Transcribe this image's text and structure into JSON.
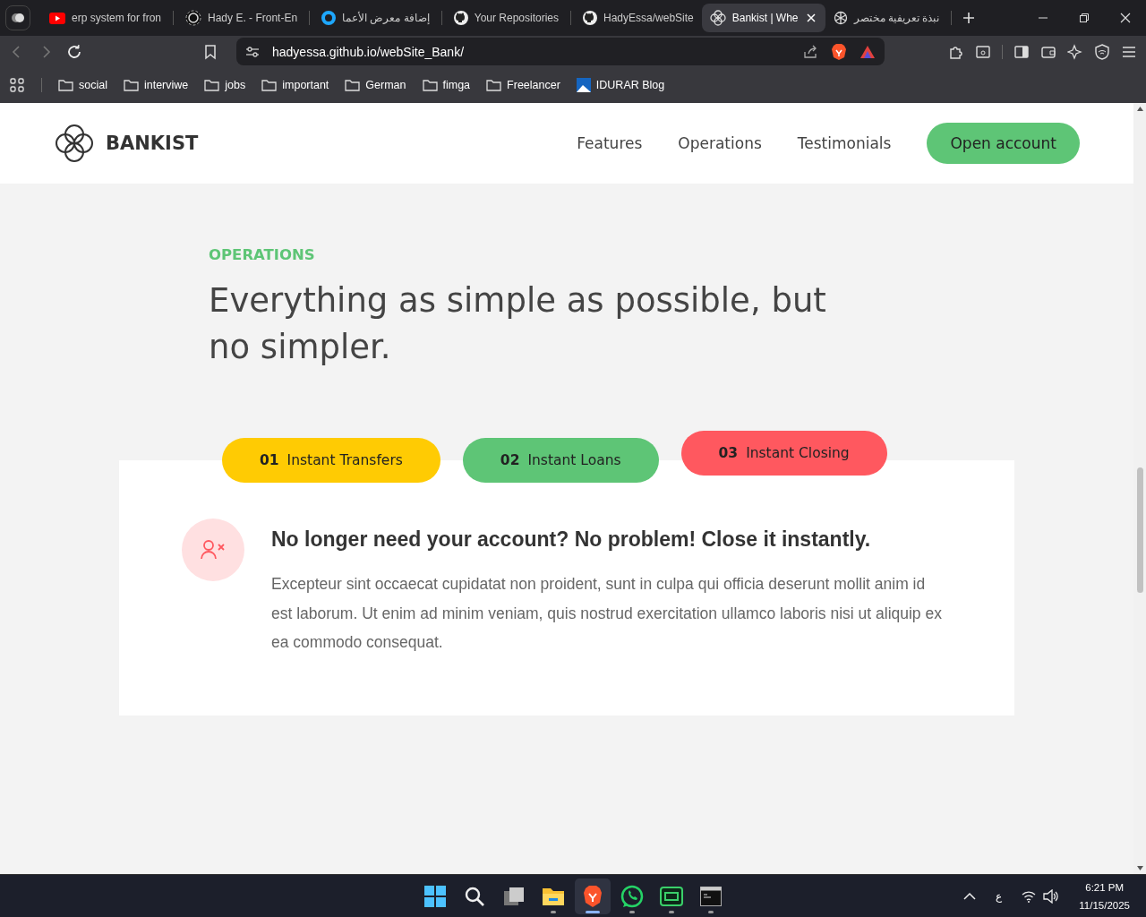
{
  "browser": {
    "tabs": [
      {
        "kind": "youtube",
        "title": "erp system for fron",
        "selected": false
      },
      {
        "kind": "upwork",
        "title": "Hady E. - Front-En",
        "selected": false
      },
      {
        "kind": "ring",
        "title": "إضافة معرض الأعما",
        "selected": false
      },
      {
        "kind": "github",
        "title": "Your Repositories",
        "selected": false
      },
      {
        "kind": "github",
        "title": "HadyEssa/webSite",
        "selected": false
      },
      {
        "kind": "bankist",
        "title": "Bankist | Whe",
        "selected": true
      },
      {
        "kind": "openai",
        "title": "نبذة تعريفية مختصر",
        "selected": false
      }
    ],
    "url": "hadyessa.github.io/webSite_Bank/",
    "bookmarks": [
      {
        "kind": "folder",
        "label": "social"
      },
      {
        "kind": "folder",
        "label": "interviwe"
      },
      {
        "kind": "folder",
        "label": "jobs"
      },
      {
        "kind": "folder",
        "label": "important"
      },
      {
        "kind": "folder",
        "label": "German"
      },
      {
        "kind": "folder",
        "label": "fimga"
      },
      {
        "kind": "folder",
        "label": "Freelancer"
      },
      {
        "kind": "site",
        "label": "IDURAR Blog"
      }
    ]
  },
  "page": {
    "logo": "BANKIST",
    "nav": [
      "Features",
      "Operations",
      "Testimonials"
    ],
    "cta": "Open account",
    "section": {
      "label": "OPERATIONS",
      "heading": "Everything as simple as possible, but no simpler."
    },
    "operations": {
      "tabs": [
        {
          "number": "01",
          "label": "Instant Transfers",
          "color": "#ffcb03",
          "selected": false
        },
        {
          "number": "02",
          "label": "Instant Loans",
          "color": "#5ec576",
          "selected": false
        },
        {
          "number": "03",
          "label": "Instant Closing",
          "color": "#ff585f",
          "selected": true
        }
      ],
      "content": {
        "title": "No longer need your account? No problem! Close it instantly.",
        "text": "Excepteur sint occaecat cupidatat non proident, sunt in culpa qui officia deserunt mollit anim id est laborum. Ut enim ad minim veniam, quis nostrud exercitation ullamco laboris nisi ut aliquip ex ea commodo consequat."
      }
    }
  },
  "taskbar": {
    "apps": [
      {
        "kind": "start",
        "running": false,
        "active": false
      },
      {
        "kind": "search",
        "running": false,
        "active": false
      },
      {
        "kind": "taskview",
        "running": false,
        "active": false
      },
      {
        "kind": "files",
        "running": true,
        "active": false
      },
      {
        "kind": "brave",
        "running": true,
        "active": true
      },
      {
        "kind": "whatsapp",
        "running": true,
        "active": false
      },
      {
        "kind": "chat",
        "running": true,
        "active": false
      },
      {
        "kind": "terminal",
        "running": true,
        "active": false
      }
    ],
    "language": "ع",
    "time": "6:21 PM",
    "date": "11/15/2025"
  }
}
